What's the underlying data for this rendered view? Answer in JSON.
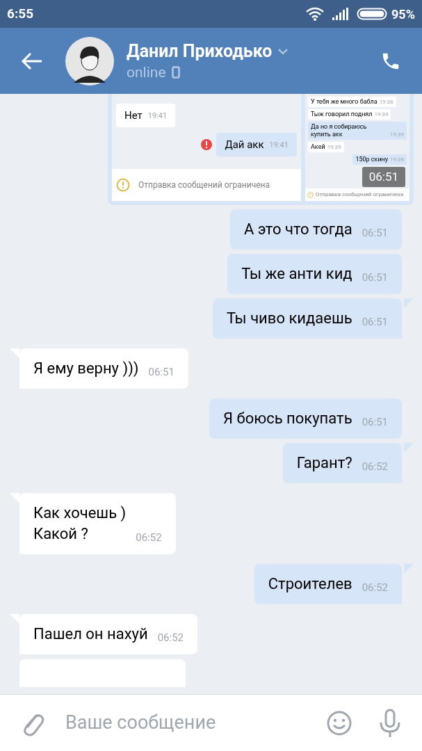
{
  "status_bar": {
    "time": "6:55",
    "battery": "95%"
  },
  "header": {
    "name": "Данил Приходько",
    "status": "online"
  },
  "photo": {
    "left": [
      {
        "kind": "in",
        "text": "Нет",
        "time": "19:41"
      },
      {
        "kind": "out",
        "text": "Дай акк",
        "time": "19:41",
        "failed": true
      }
    ],
    "notice": "Отправка сообщений ограничена",
    "right": [
      {
        "kind": "in",
        "text": "У тебя же много бабла",
        "time": "19:38"
      },
      {
        "kind": "in",
        "text": "Тыж говорил поднял",
        "time": "19:39"
      },
      {
        "kind": "out",
        "text": "Да но я собираюсь купить акк",
        "time": "19:39"
      },
      {
        "kind": "in",
        "text": "Акей",
        "time": "19:39"
      },
      {
        "kind": "out",
        "text": "150р скину",
        "time": "19:39"
      }
    ],
    "right_notice": "Отправка сообщений ограничена",
    "time": "06:51"
  },
  "messages": [
    {
      "kind": "out",
      "lines": [
        "А это что тогда"
      ],
      "time": "06:51"
    },
    {
      "kind": "out",
      "lines": [
        "Ты же анти кид"
      ],
      "time": "06:51"
    },
    {
      "kind": "out",
      "lines": [
        "Ты чиво кидаешь"
      ],
      "time": "06:51"
    },
    {
      "kind": "in",
      "lines": [
        "Я ему верну )))"
      ],
      "time": "06:51"
    },
    {
      "kind": "out",
      "lines": [
        "Я боюсь покупать"
      ],
      "time": "06:51"
    },
    {
      "kind": "out",
      "lines": [
        "Гарант?"
      ],
      "time": "06:52"
    },
    {
      "kind": "in",
      "lines": [
        "Как хочешь )",
        "Какой ?"
      ],
      "time": "06:52"
    },
    {
      "kind": "out",
      "lines": [
        "Строителев"
      ],
      "time": "06:52"
    },
    {
      "kind": "in",
      "lines": [
        "Пашел он нахуй"
      ],
      "time": "06:52"
    }
  ],
  "composer": {
    "placeholder": "Ваше сообщение"
  }
}
